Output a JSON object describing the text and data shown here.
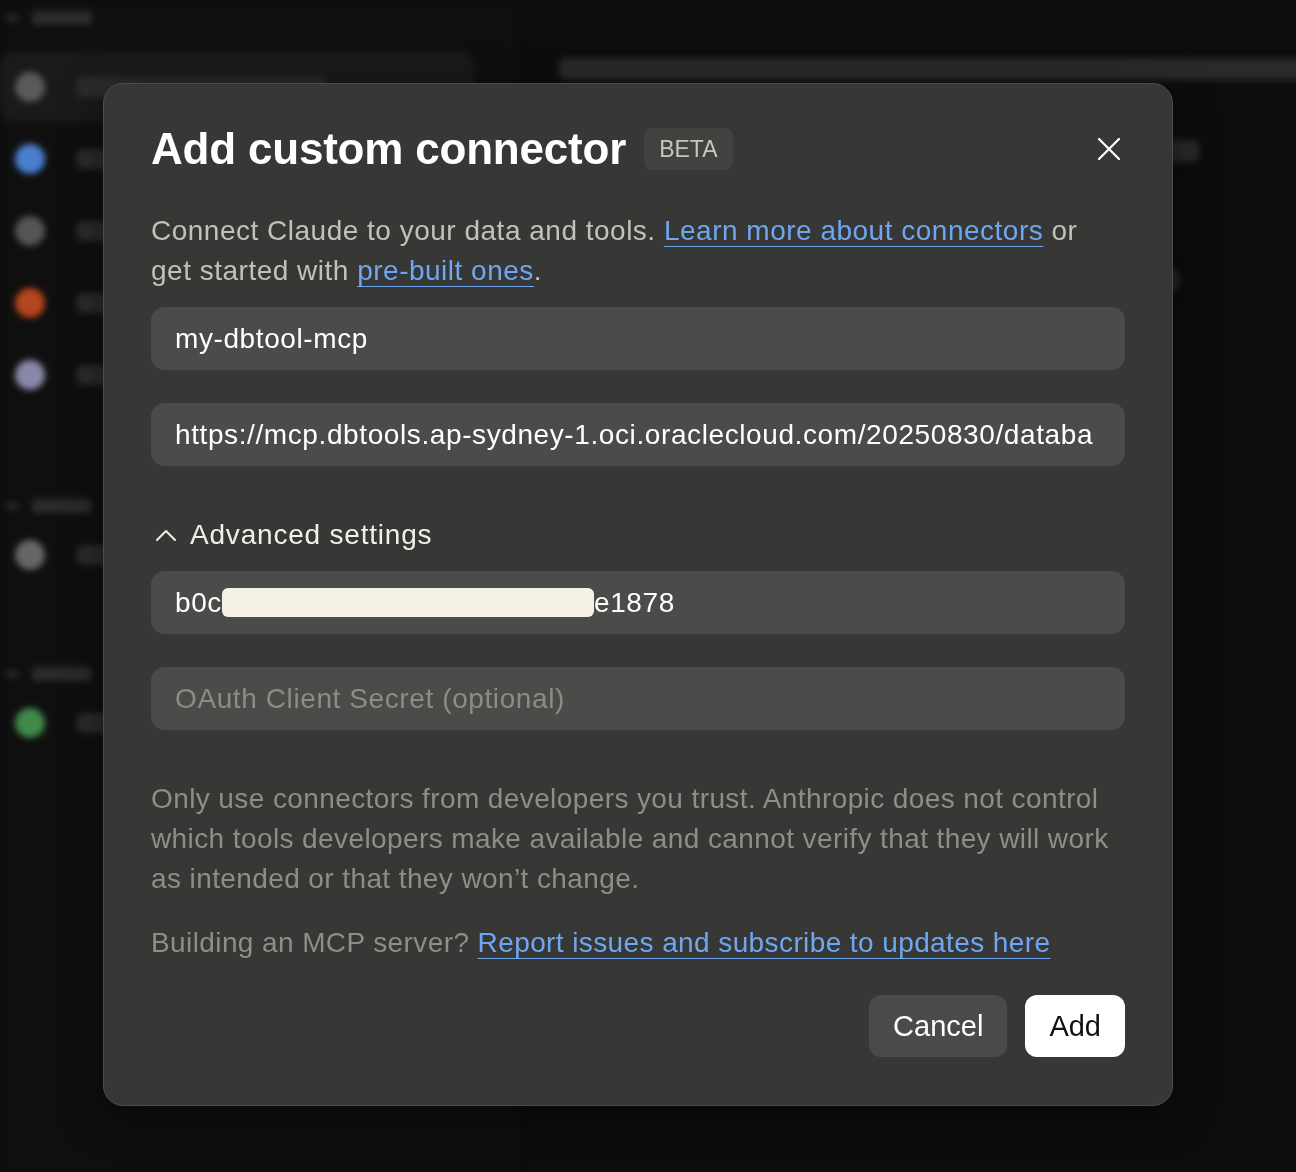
{
  "dialog": {
    "title": "Add custom connector",
    "badge": "BETA"
  },
  "intro": [
    {
      "kind": "text",
      "text": "Connect Claude to your data and tools. "
    },
    {
      "kind": "link",
      "text": "Learn more about connectors"
    },
    {
      "kind": "text",
      "text": " or get started with "
    },
    {
      "kind": "link",
      "text": "pre-built ones"
    },
    {
      "kind": "text",
      "text": "."
    }
  ],
  "fields": [
    {
      "kind": "text",
      "value": "my-dbtool-mcp"
    },
    {
      "kind": "text",
      "value": "https://mcp.dbtools.ap-sydney-1.oci.oraclecloud.com/20250830/databa"
    }
  ],
  "advanced": {
    "label": "Advanced settings",
    "expanded": true,
    "fields": [
      {
        "kind": "redacted",
        "value_start": "b0c",
        "value_end": "e1878"
      },
      {
        "kind": "text",
        "placeholder": "OAuth Client Secret (optional)"
      }
    ]
  },
  "disclaimer": "Only use connectors from developers you trust. Anthropic does not control which tools developers make available and cannot verify that they will work as intended or that they won’t change.",
  "footer_note": [
    {
      "kind": "text",
      "text": "Building an MCP server? "
    },
    {
      "kind": "link",
      "text": "Report issues and subscribe to updates here"
    }
  ],
  "buttons": [
    {
      "kind": "secondary",
      "label": "Cancel"
    },
    {
      "kind": "primary",
      "label": "Add"
    }
  ]
}
